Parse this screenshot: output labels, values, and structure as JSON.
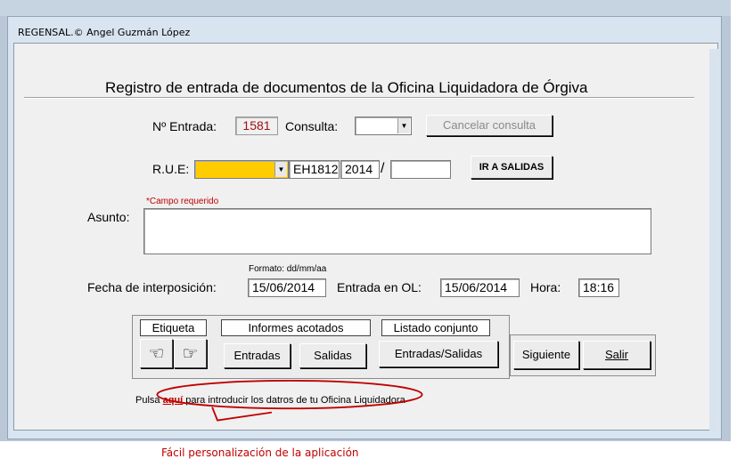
{
  "window": {
    "title": "REGENSAL.© Angel Guzmán López"
  },
  "form": {
    "heading": "Registro de entrada de documentos de la Oficina Liquidadora de Órgiva",
    "entrada_label": "Nº Entrada:",
    "entrada_value": "1581",
    "consulta_label": "Consulta:",
    "consulta_value": "",
    "cancel_label": "Cancelar consulta",
    "rue_label": "R.U.E:",
    "rue_select_value": "",
    "rue_code": "EH1812",
    "rue_year": "2014",
    "rue_slash": "/",
    "rue_number": "",
    "ir_salidas_label": "IR A SALIDAS",
    "required_note": "*Campo requerido",
    "asunto_label": "Asunto:",
    "asunto_value": "",
    "format_hint": "Formato: dd/mm/aa",
    "fecha_label": "Fecha de interposición:",
    "fecha_value": "15/06/2014",
    "entrada_ol_label": "Entrada en OL:",
    "entrada_ol_value": "15/06/2014",
    "hora_label": "Hora:",
    "hora_value": "18:16"
  },
  "actions": {
    "etiqueta_label": "Etiqueta",
    "informes_label": "Informes acotados",
    "listado_label": "Listado conjunto",
    "entradas_label": "Entradas",
    "salidas_label": "Salidas",
    "entradas_salidas_label": "Entradas/Salidas",
    "siguiente_label": "Siguiente",
    "salir_label": "Salir",
    "hand_left": "☜",
    "hand_right": "☞"
  },
  "hint": {
    "prefix": "Pulsa",
    "link": "aquí",
    "suffix": "para introducir los datros de tu Oficina Liquidadora"
  },
  "caption": "Fácil personalización de la aplicación",
  "colors": {
    "entrada_number": "#a01010",
    "rue_highlight": "#ffcc00",
    "annotation": "#c00000"
  }
}
